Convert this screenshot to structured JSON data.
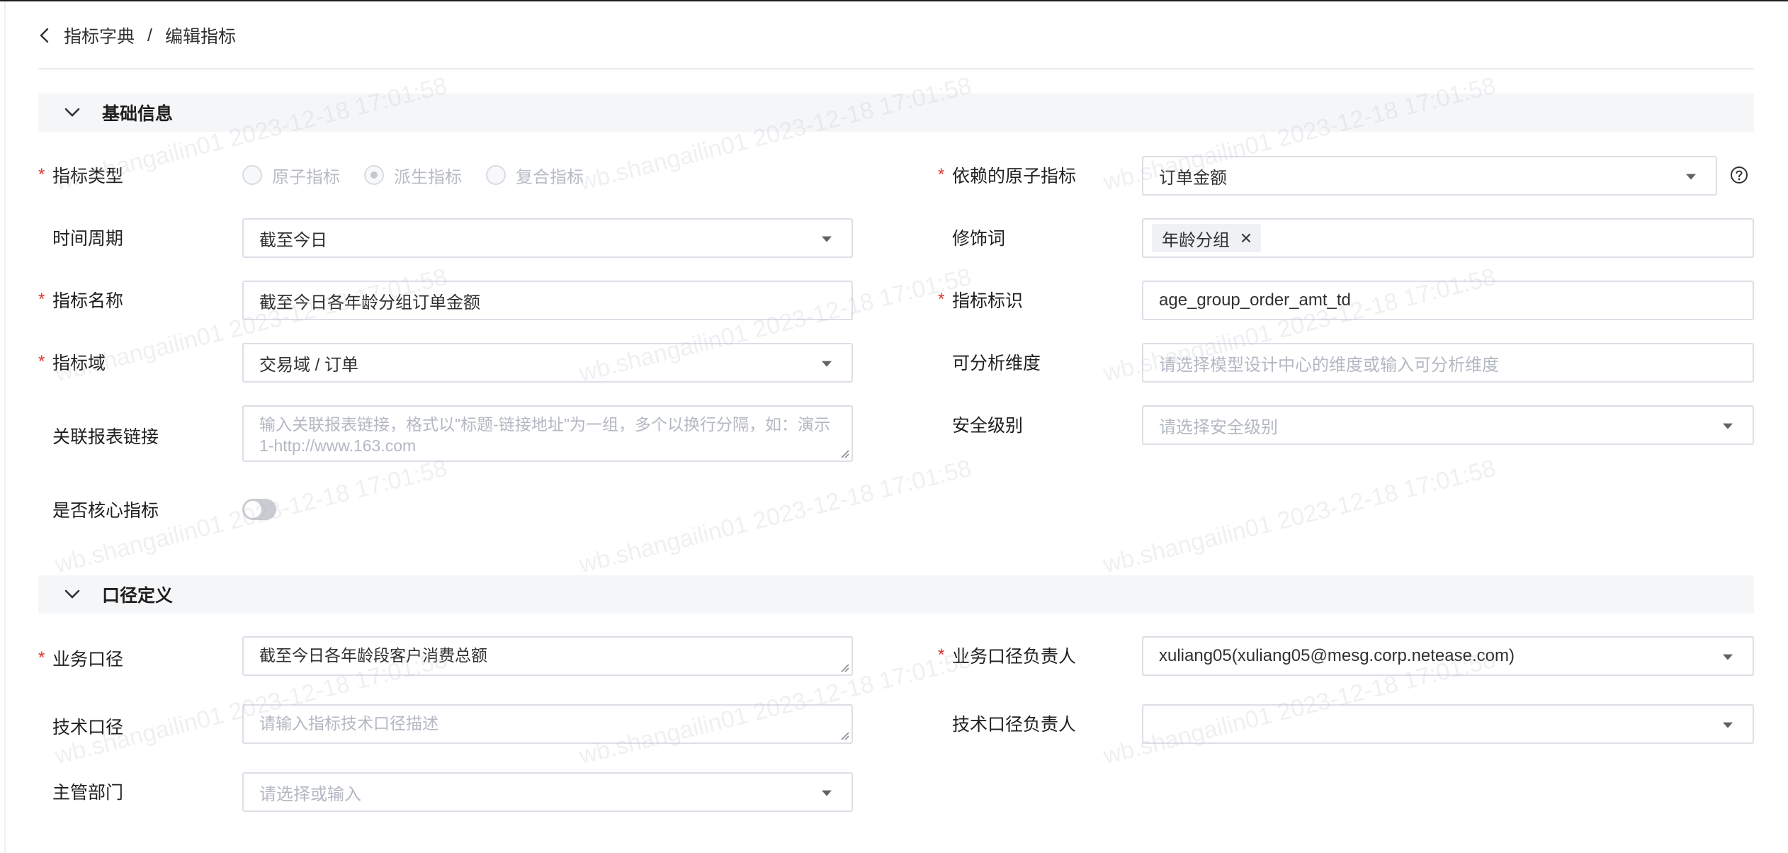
{
  "breadcrumb": {
    "parent": "指标字典",
    "separator": "/",
    "current": "编辑指标"
  },
  "sections": {
    "basic": "基础信息",
    "caliber": "口径定义"
  },
  "basic": {
    "metric_type": {
      "label": "指标类型",
      "options": [
        "原子指标",
        "派生指标",
        "复合指标"
      ],
      "selected": "派生指标"
    },
    "depends_atomic": {
      "label": "依赖的原子指标",
      "value": "订单金额"
    },
    "time_period": {
      "label": "时间周期",
      "value": "截至今日"
    },
    "modifier": {
      "label": "修饰词",
      "tags": [
        "年龄分组"
      ]
    },
    "metric_name": {
      "label": "指标名称",
      "value": "截至今日各年龄分组订单金额"
    },
    "metric_id": {
      "label": "指标标识",
      "value": "age_group_order_amt_td"
    },
    "metric_domain": {
      "label": "指标域",
      "value": "交易域 / 订单"
    },
    "dimensions": {
      "label": "可分析维度",
      "placeholder": "请选择模型设计中心的维度或输入可分析维度"
    },
    "report_link": {
      "label": "关联报表链接",
      "placeholder": "输入关联报表链接，格式以\"标题-链接地址\"为一组，多个以换行分隔，如：演示1-http://www.163.com"
    },
    "security_level": {
      "label": "安全级别",
      "placeholder": "请选择安全级别"
    },
    "is_core": {
      "label": "是否核心指标",
      "on": false
    }
  },
  "caliber": {
    "business": {
      "label": "业务口径",
      "value": "截至今日各年龄段客户消费总额"
    },
    "business_owner": {
      "label": "业务口径负责人",
      "value": "xuliang05(xuliang05@mesg.corp.netease.com)"
    },
    "technical": {
      "label": "技术口径",
      "placeholder": "请输入指标技术口径描述"
    },
    "technical_owner": {
      "label": "技术口径负责人",
      "value": ""
    },
    "department": {
      "label": "主管部门",
      "placeholder": "请选择或输入"
    }
  },
  "watermark": "wb.shangailin01 2023-12-18 17:01:58",
  "colors": {
    "required": "#e0342a",
    "border": "#dcdfe6",
    "section_bg": "#f5f6f8",
    "placeholder": "#b3b8c2"
  }
}
